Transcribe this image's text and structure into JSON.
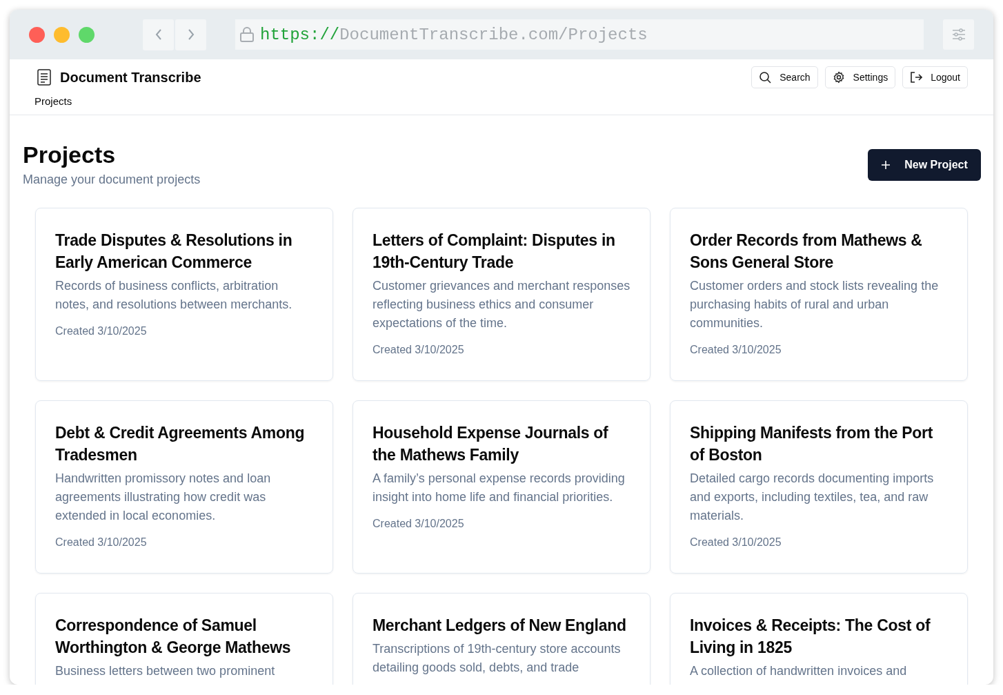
{
  "browser": {
    "url_scheme": "https://",
    "url_rest": "DocumentTranscribe.com/Projects"
  },
  "app": {
    "title": "Document Transcribe",
    "nav": [
      {
        "label": "Projects"
      }
    ],
    "actions": [
      {
        "kind": "search",
        "label": "Search"
      },
      {
        "kind": "settings",
        "label": "Settings"
      },
      {
        "kind": "logout",
        "label": "Logout"
      }
    ]
  },
  "page": {
    "title": "Projects",
    "subtitle": "Manage your document projects",
    "new_button": "New Project"
  },
  "projects": [
    {
      "title": "Trade Disputes & Resolutions in Early American Commerce",
      "description": "Records of business conflicts, arbitration notes, and resolutions between merchants.",
      "created": "Created 3/10/2025"
    },
    {
      "title": "Letters of Complaint: Disputes in 19th-Century Trade",
      "description": "Customer grievances and merchant responses reflecting business ethics and consumer expectations of the time.",
      "created": "Created 3/10/2025"
    },
    {
      "title": "Order Records from Mathews & Sons General Store",
      "description": "Customer orders and stock lists revealing the purchasing habits of rural and urban communities.",
      "created": "Created 3/10/2025"
    },
    {
      "title": "Debt & Credit Agreements Among Tradesmen",
      "description": "Handwritten promissory notes and loan agreements illustrating how credit was extended in local economies.",
      "created": "Created 3/10/2025"
    },
    {
      "title": "Household Expense Journals of the Mathews Family",
      "description": "A family’s personal expense records providing insight into home life and financial priorities.",
      "created": "Created 3/10/2025"
    },
    {
      "title": "Shipping Manifests from the Port of Boston",
      "description": "Detailed cargo records documenting imports and exports, including textiles, tea, and raw materials.",
      "created": "Created 3/10/2025"
    },
    {
      "title": "Correspondence of Samuel Worthington & George Mathews",
      "description": "Business letters between two prominent"
    },
    {
      "title": "Merchant Ledgers of New England",
      "description": "Transcriptions of 19th-century store accounts detailing goods sold, debts, and trade"
    },
    {
      "title": "Invoices & Receipts: The Cost of Living in 1825",
      "description": "A collection of handwritten invoices and"
    }
  ]
}
